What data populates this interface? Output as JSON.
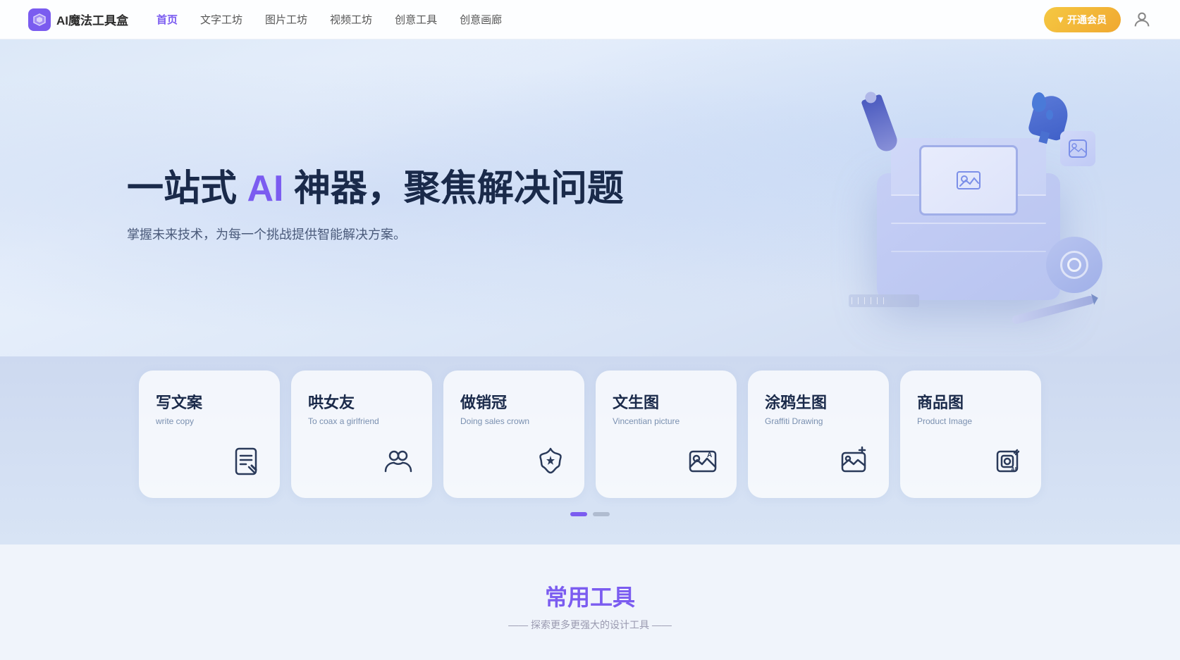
{
  "nav": {
    "logo_text": "AI魔法工具盒",
    "links": [
      {
        "label": "首页",
        "active": true
      },
      {
        "label": "文字工坊",
        "active": false
      },
      {
        "label": "图片工坊",
        "active": false
      },
      {
        "label": "视频工坊",
        "active": false
      },
      {
        "label": "创意工具",
        "active": false
      },
      {
        "label": "创意画廊",
        "active": false
      }
    ],
    "vip_button": "开通会员"
  },
  "hero": {
    "title_prefix": "一站式 ",
    "title_ai": "AI",
    "title_suffix": " 神器，聚焦解决问题",
    "subtitle": "掌握未来技术，为每一个挑战提供智能解决方案。"
  },
  "cards": [
    {
      "title": "写文案",
      "subtitle": "write copy",
      "icon": "document"
    },
    {
      "title": "哄女友",
      "subtitle": "To coax a girlfriend",
      "icon": "people"
    },
    {
      "title": "做销冠",
      "subtitle": "Doing sales crown",
      "icon": "star"
    },
    {
      "title": "文生图",
      "subtitle": "Vincentian picture",
      "icon": "image-text"
    },
    {
      "title": "涂鸦生图",
      "subtitle": "Graffiti Drawing",
      "icon": "image-plus"
    },
    {
      "title": "商品图",
      "subtitle": "Product Image",
      "icon": "product"
    }
  ],
  "dots": [
    {
      "active": true
    },
    {
      "active": false
    }
  ],
  "tools_section": {
    "title": "常用工具",
    "subtitle_left": "——  探索更多更强大的设计工具  ——"
  },
  "colors": {
    "accent": "#7b5cf0",
    "gold": "#f0a830",
    "dark": "#1a2a4a",
    "muted": "#7a90b0"
  }
}
